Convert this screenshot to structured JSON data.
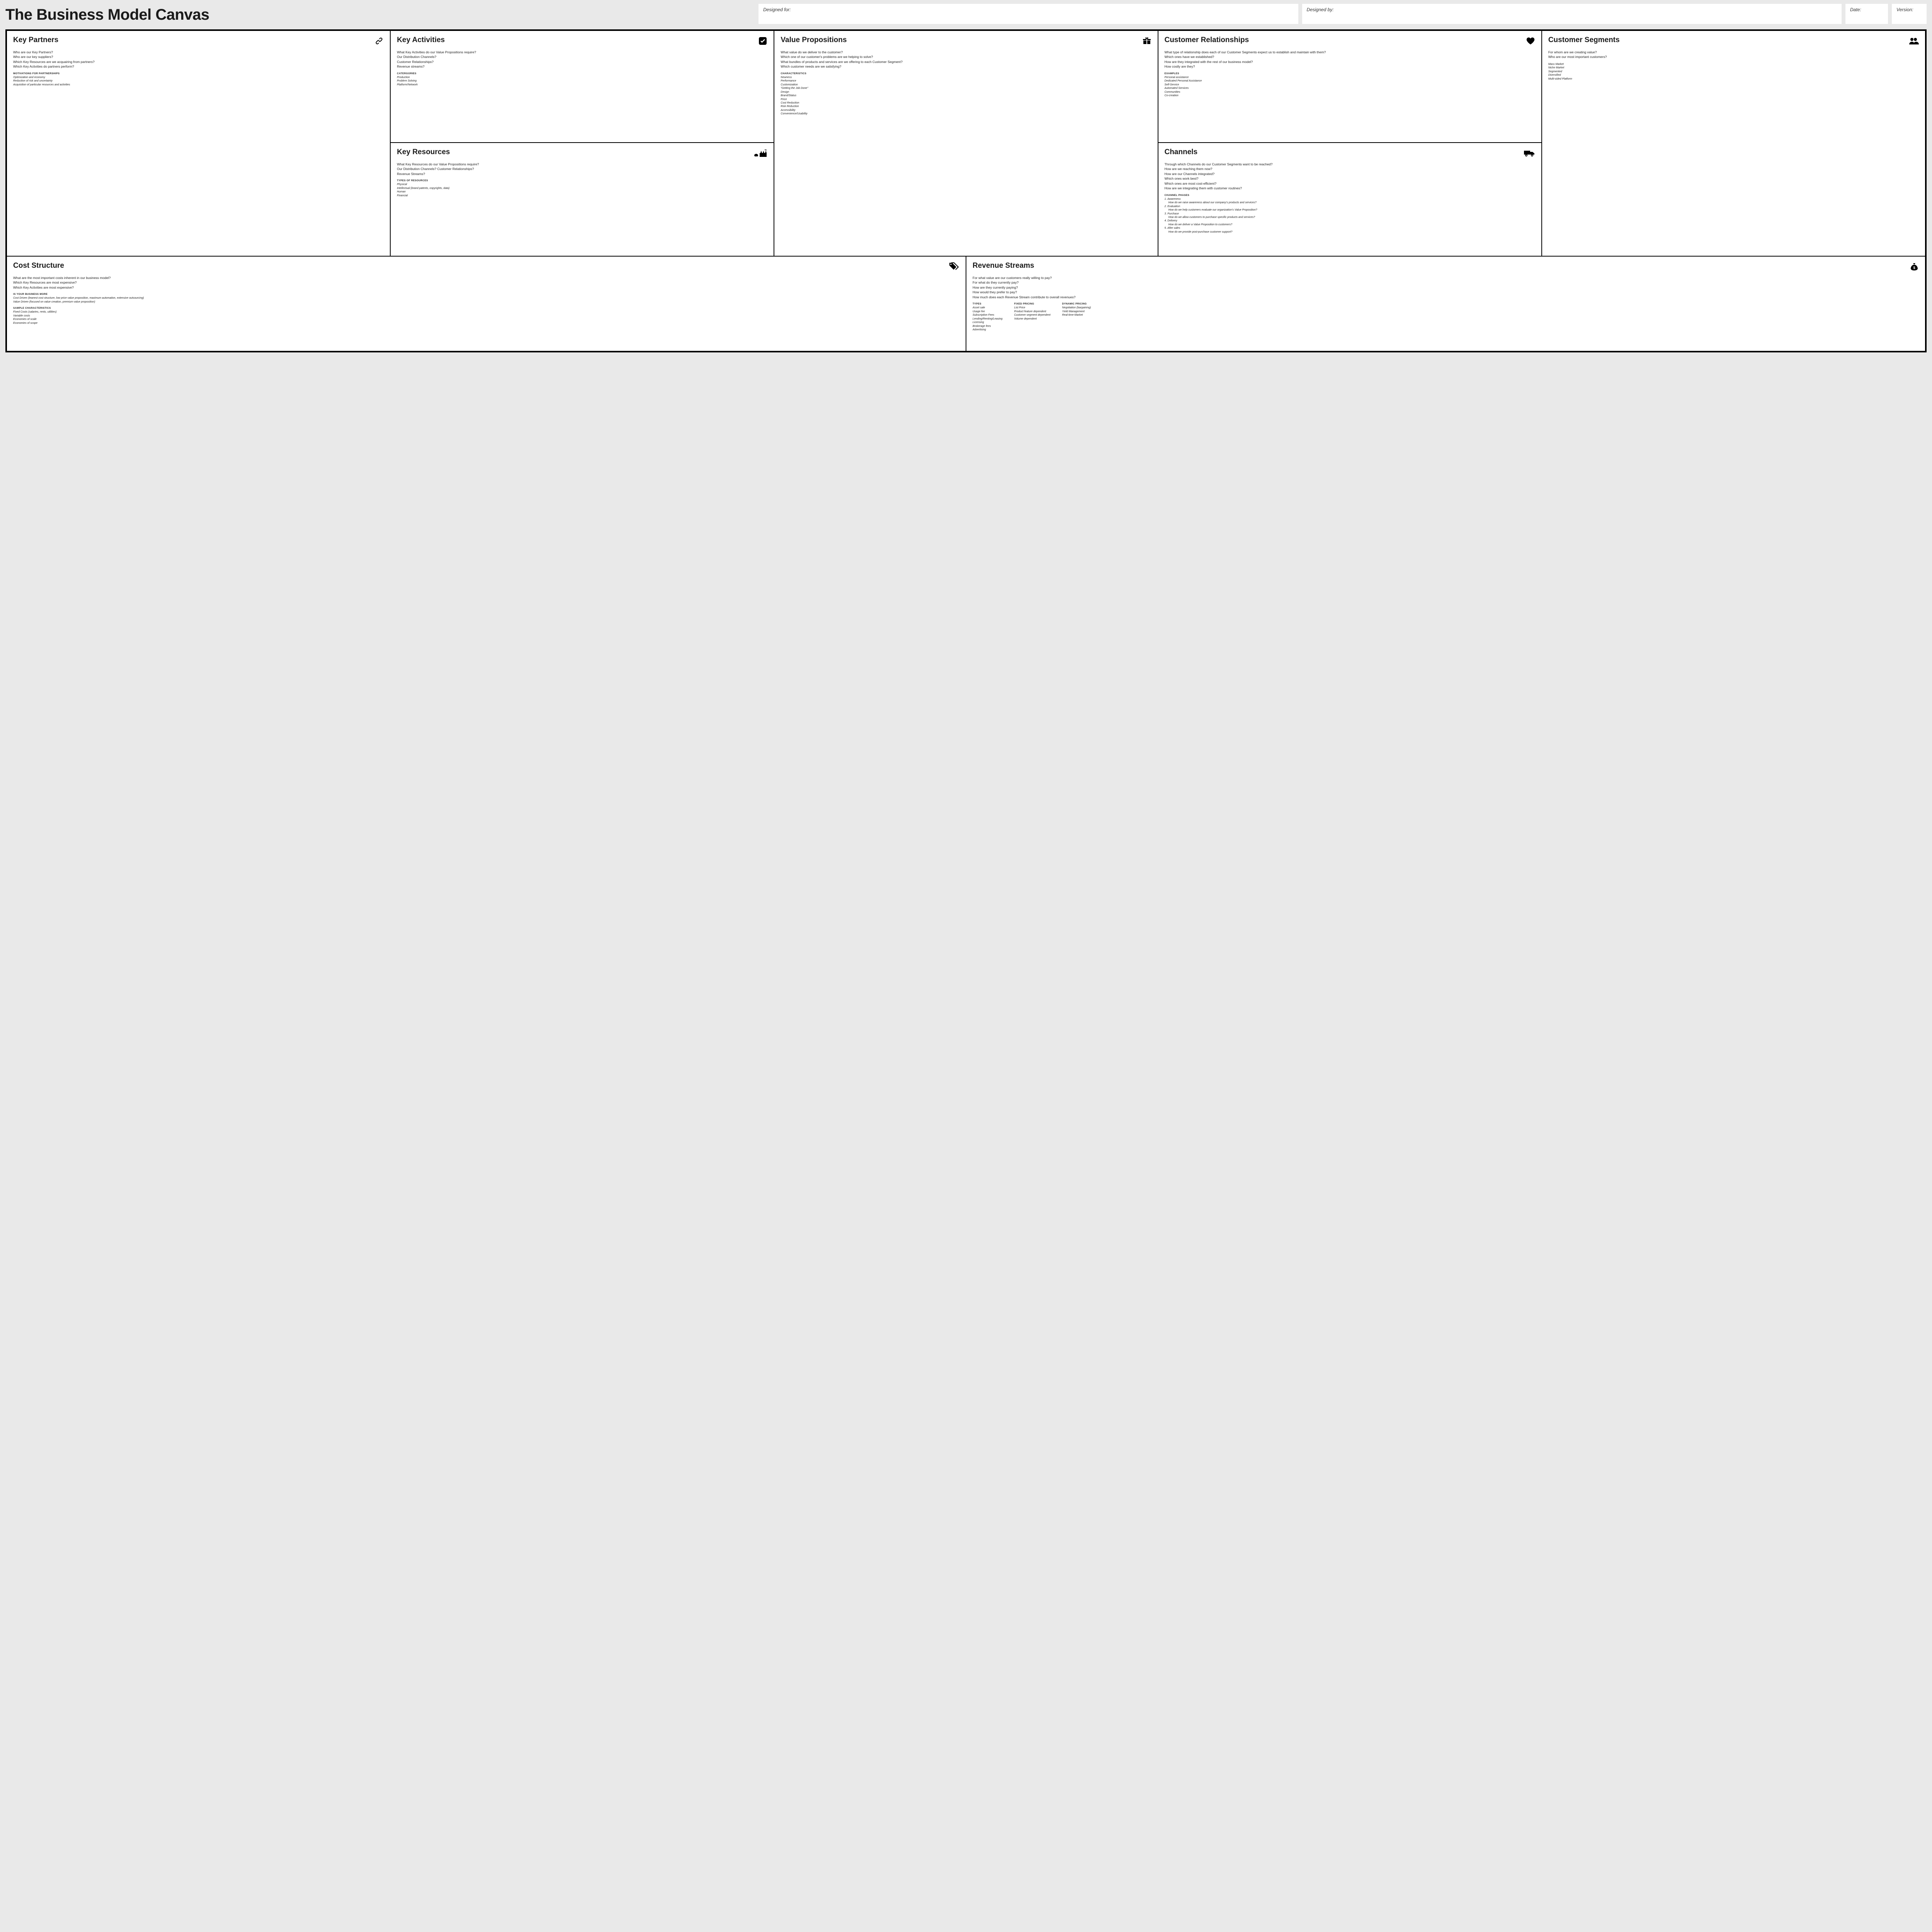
{
  "title": "The Business Model Canvas",
  "meta": {
    "designed_for": "Designed for:",
    "designed_by": "Designed by:",
    "date": "Date:",
    "version": "Version:"
  },
  "key_partners": {
    "title": "Key Partners",
    "q": [
      "Who are our Key Partners?",
      "Who are our key suppliers?",
      "Which Key Resources are we acquairing from partners?",
      "Which Key Activities do partners perform?"
    ],
    "sub_head": "motivations for partnerships",
    "sub": [
      "Optimization and economy",
      "Reduction of risk and uncertainty",
      "Acquisition of particular resources and activities"
    ]
  },
  "key_activities": {
    "title": "Key Activities",
    "q": [
      "What Key Activities do our Value Propositions require?",
      "Our Distribution Channels?",
      "Customer Relationships?",
      "Revenue streams?"
    ],
    "sub_head": "catergories",
    "sub": [
      "Production",
      "Problem Solving",
      "Platform/Network"
    ]
  },
  "key_resources": {
    "title": "Key Resources",
    "q": [
      "What Key Resources do our Value Propositions require?",
      "Our Distribution Channels? Customer Relationships?",
      "Revenue Streams?"
    ],
    "sub_head": "types of resources",
    "sub": [
      "Physical",
      "Intellectual (brand patents, copyrights, data)",
      "Human",
      "Financial"
    ]
  },
  "value_propositions": {
    "title": "Value Propositions",
    "q": [
      "What value do we deliver to the customer?",
      "Which one of our customer's problems are we helping to solve?",
      "What bundles of products and services are we offering to each Customer Segment?",
      "Which customer needs are we satisfying?"
    ],
    "sub_head": "characteristics",
    "sub": [
      "Newness",
      "Performance",
      "Customization",
      "\"Getting the Job Done\"",
      "Design",
      "Brand/Status",
      "Price",
      "Cost Reduction",
      "Risk Reduction",
      "Accessibility",
      "Convenience/Usability"
    ]
  },
  "customer_relationships": {
    "title": "Customer Relationships",
    "q": [
      "What type of relationship does each of our Customer Segments expect us to establish and maintain with them?",
      "Which ones have we established?",
      "How are they integrated with the rest of our business model?",
      "How costly are they?"
    ],
    "sub_head": "examples",
    "sub": [
      "Personal assistance",
      "Dedicated Personal Assistance",
      "Self-Service",
      "Automated Services",
      "Communities",
      "Co-creation"
    ]
  },
  "channels": {
    "title": "Channels",
    "q": [
      "Through which Channels do our Customer Segments want to be reached?",
      "How are we reaching them now?",
      "How are our Channels integrated?",
      "Which ones work best?",
      "Which ones are most cost-efficient?",
      "How are we integrating them with customer routines?"
    ],
    "sub_head": "channel phases",
    "phases": [
      {
        "n": "1. Awareness",
        "d": "How do we raise awareness about our company's products and services?"
      },
      {
        "n": "2. Evaluation",
        "d": "How do we help customers evaluate our organization's Value Proposition?"
      },
      {
        "n": "3. Purchase",
        "d": "How do we allow customers to purchase specific products and services?"
      },
      {
        "n": "4. Delivery",
        "d": "How do we deliver a Value Proposition to customers?"
      },
      {
        "n": "5. After sales",
        "d": "How do we provide post-purchase customer support?"
      }
    ]
  },
  "customer_segments": {
    "title": "Customer Segments",
    "q": [
      "For whom are we creating value?",
      "Who are our most important customers?"
    ],
    "sub": [
      "Mass Market",
      "Niche Market",
      "Segmented",
      "Diversified",
      "Multi-sided Platform"
    ]
  },
  "cost_structure": {
    "title": "Cost Structure",
    "q": [
      "What are the most important costs inherent in our business model?",
      "Which Key Resources are most expensive?",
      "Which Key Activities are most expensive?"
    ],
    "sub_head1": "is your business more",
    "sub1": [
      "Cost Driven (leanest cost structure, low price value proposition, maximum automation, extensive outsourcing)",
      "Value Driven (focused on value creation, premium value proposition)"
    ],
    "sub_head2": "sample characteristics",
    "sub2": [
      "Fixed Costs (salaries, rents, utilities)",
      "Variable costs",
      "Economies of scale",
      "Economies of scope"
    ]
  },
  "revenue_streams": {
    "title": "Revenue Streams",
    "q": [
      "For what value are our customers really willing to pay?",
      "For what do they currently pay?",
      "How are they currently paying?",
      "How would they prefer to pay?",
      "How much does each Revenue Stream contribute to overall revenues?"
    ],
    "types_head": "types",
    "types": [
      "Asset sale",
      "Usage fee",
      "Subscription Fees",
      "Lending/Renting/Leasing",
      "Licensing",
      "Brokerage fees",
      "Advertising"
    ],
    "fixed_head": "fixed pricing",
    "fixed": [
      "List Price",
      "Product feature dependent",
      "Customer segment dependent",
      "Volume dependent"
    ],
    "dynamic_head": "dynamic pricing",
    "dynamic": [
      "Negotiation (bargaining)",
      "Yield Management",
      "Real-time-Market"
    ]
  }
}
